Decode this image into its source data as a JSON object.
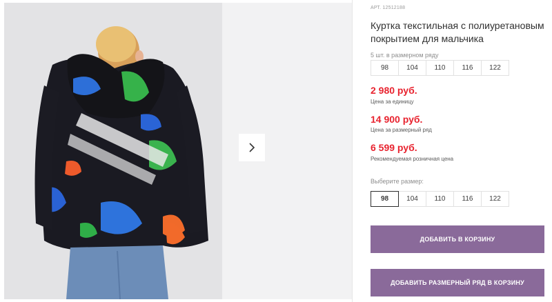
{
  "gallery": {
    "next_icon": "chevron-right-icon"
  },
  "product": {
    "article": "АРТ. 12512188",
    "title": "Куртка текстильная с полиуретановым покрытием для мальчика",
    "set_note": "5 шт. в размерном ряду",
    "set_sizes": [
      "98",
      "104",
      "110",
      "116",
      "122"
    ]
  },
  "prices": {
    "unit_price": "2 980 руб.",
    "unit_label": "Цена за единицу",
    "set_price": "14 900 руб.",
    "set_label": "Цена за размерный ряд",
    "retail_price": "6 599 руб.",
    "retail_label": "Рекомендуемая розничная цена"
  },
  "size_select": {
    "label": "Выберите размер:",
    "options": [
      "98",
      "104",
      "110",
      "116",
      "122"
    ],
    "selected": "98"
  },
  "actions": {
    "add_to_cart": "ДОБАВИТЬ В КОРЗИНУ",
    "add_set_to_cart": "ДОБАВИТЬ РАЗМЕРНЫЙ РЯД В КОРЗИНУ"
  },
  "colors": {
    "price_red": "#e8232f",
    "button_purple": "#8a6a9a"
  }
}
